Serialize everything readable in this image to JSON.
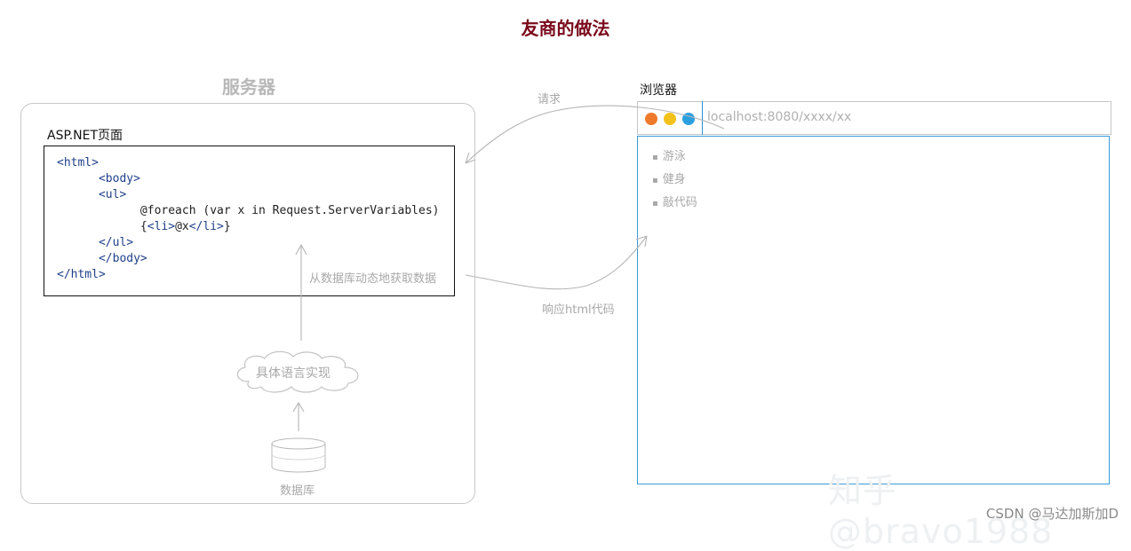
{
  "title": "友商的做法",
  "server": {
    "label": "服务器",
    "page_label": "ASP.NET页面",
    "code_lines": [
      {
        "indent": "",
        "parts": [
          {
            "t": "<html>",
            "c": "tag"
          }
        ]
      },
      {
        "indent": "      ",
        "parts": [
          {
            "t": "<body>",
            "c": "tag"
          }
        ]
      },
      {
        "indent": "      ",
        "parts": [
          {
            "t": "<ul>",
            "c": "tag"
          }
        ]
      },
      {
        "indent": "            ",
        "parts": [
          {
            "t": "@foreach (var x in Request.ServerVariables)",
            "c": "plain"
          }
        ]
      },
      {
        "indent": "            ",
        "parts": [
          {
            "t": "{",
            "c": "plain"
          },
          {
            "t": "<li>",
            "c": "tag"
          },
          {
            "t": "@x",
            "c": "plain"
          },
          {
            "t": "</li>",
            "c": "tag"
          },
          {
            "t": "}",
            "c": "plain"
          }
        ]
      },
      {
        "indent": "      ",
        "parts": [
          {
            "t": "</ul>",
            "c": "tag"
          }
        ]
      },
      {
        "indent": "      ",
        "parts": [
          {
            "t": "</body>",
            "c": "tag"
          }
        ]
      },
      {
        "indent": "",
        "parts": [
          {
            "t": "</html>",
            "c": "tag"
          }
        ]
      }
    ],
    "db_fetch_label": "从数据库动态地获取数据",
    "cloud_label": "具体语言实现",
    "database_label": "数据库"
  },
  "arrows": {
    "request_label": "请求",
    "response_label": "响应html代码"
  },
  "browser": {
    "label": "浏览器",
    "url": "localhost:8080/xxxx/xx",
    "dot_colors": [
      "#f07a2b",
      "#f2c21b",
      "#2a9fe0"
    ],
    "list_items": [
      "游泳",
      "健身",
      "敲代码"
    ]
  },
  "watermark": "知乎 @bravo1988",
  "csdn_credit": "CSDN @马达加斯加D",
  "colors": {
    "title": "#7a0a1c",
    "muted": "#a8a8a8",
    "browser_border": "#3b9bd6"
  }
}
